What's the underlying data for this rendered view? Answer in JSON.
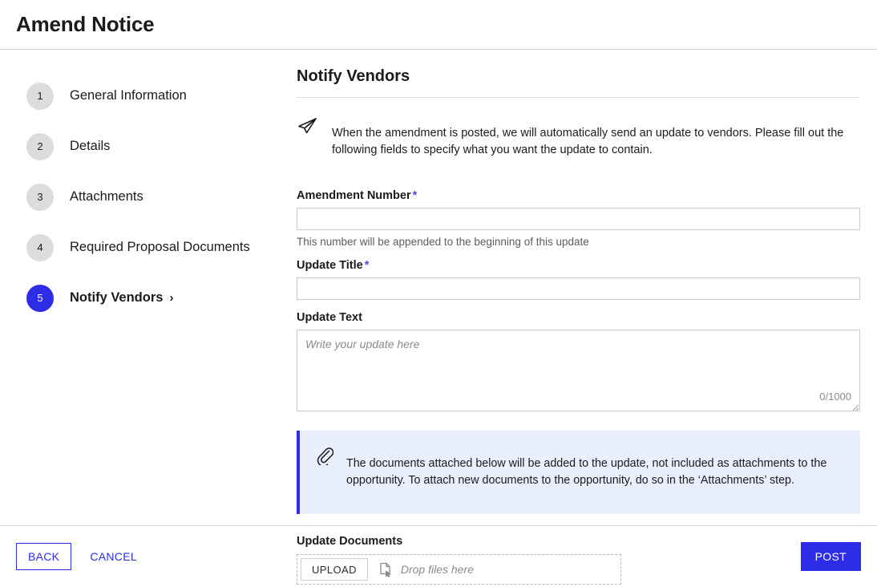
{
  "header": {
    "title": "Amend Notice"
  },
  "sidebar": {
    "steps": [
      {
        "number": "1",
        "label": "General Information",
        "active": false
      },
      {
        "number": "2",
        "label": "Details",
        "active": false
      },
      {
        "number": "3",
        "label": "Attachments",
        "active": false
      },
      {
        "number": "4",
        "label": "Required Proposal Documents",
        "active": false
      },
      {
        "number": "5",
        "label": "Notify Vendors",
        "active": true
      }
    ],
    "active_chevron": "›"
  },
  "main": {
    "section_title": "Notify Vendors",
    "intro_icon": "send-icon",
    "intro_text": "When the amendment is posted, we will automatically send an update to vendors. Please fill out the following fields to specify what you want the update to contain.",
    "fields": {
      "amendment_number": {
        "label": "Amendment Number",
        "required_marker": "*",
        "value": "",
        "placeholder": "",
        "helper": "This number will be appended to the beginning of this update"
      },
      "update_title": {
        "label": "Update Title",
        "required_marker": "*",
        "value": "",
        "placeholder": ""
      },
      "update_text": {
        "label": "Update Text",
        "value": "",
        "placeholder": "Write your update here",
        "counter": "0/1000"
      }
    },
    "banner": {
      "icon": "paperclip-icon",
      "text": "The documents attached below will be added to the update, not included as attachments to the opportunity. To attach new documents to the opportunity, do so in the ‘Attachments’ step.",
      "accent_color": "#2d2de8",
      "background_color": "#eaeffd"
    },
    "upload": {
      "label": "Update Documents",
      "button_label": "UPLOAD",
      "drop_text": "Drop files here",
      "drop_icon": "file-drop-icon"
    }
  },
  "footer": {
    "back_label": "BACK",
    "cancel_label": "CANCEL",
    "post_label": "POST",
    "primary_color": "#2d2de8"
  }
}
